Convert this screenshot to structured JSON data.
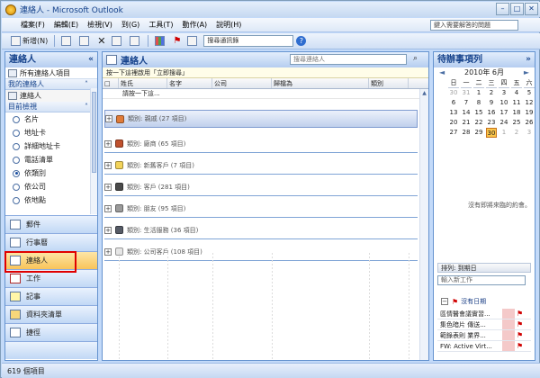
{
  "window": {
    "title": "連絡人 - Microsoft Outlook"
  },
  "menubar": {
    "items": [
      "檔案(F)",
      "編輯(E)",
      "檢視(V)",
      "到(G)",
      "工具(T)",
      "動作(A)",
      "說明(H)"
    ],
    "help_placeholder": "鍵入需要解答的問題"
  },
  "toolbar": {
    "new_label": "新增(N)",
    "address_placeholder": "搜尋通訊錄"
  },
  "nav": {
    "title": "連絡人",
    "all_items": "所有連絡人項目",
    "my_contacts_header": "我的連絡人",
    "my_contacts_item": "連絡人",
    "current_view_header": "目前檢視",
    "views": [
      "名片",
      "地址卡",
      "詳細地址卡",
      "電話清單",
      "依類別",
      "依公司",
      "依地點"
    ],
    "selected_view": 4,
    "buttons": [
      "郵件",
      "行事曆",
      "連絡人",
      "工作",
      "記事",
      "資料夾清單",
      "捷徑"
    ]
  },
  "main": {
    "title": "連絡人",
    "search_placeholder": "搜尋連絡人",
    "hint": "按一下這裡啟用「立即搜尋」",
    "columns": [
      "姓氏",
      "名字",
      "公司",
      "歸檔為",
      "類別"
    ],
    "click_add": "請按一下這...",
    "groups": [
      {
        "label": "類別: 親戚 (27 項目)",
        "color": "#e07b39"
      },
      {
        "label": "類別: 廠商 (65 項目)",
        "color": "#c0512d"
      },
      {
        "label": "類別: 新舊客戶 (7 項目)",
        "color": "#f3d35a"
      },
      {
        "label": "類別: 客戶 (281 項目)",
        "color": "#4a4a4a"
      },
      {
        "label": "類別: 朋友 (95 項目)",
        "color": "#9a9a9a"
      },
      {
        "label": "類別: 生活服務 (36 項目)",
        "color": "#565b66"
      },
      {
        "label": "類別: 公司客戶 (108 項目)",
        "color": "#e6e6e6"
      }
    ]
  },
  "todo": {
    "title": "待辦事項列",
    "month": "2010年 6月",
    "weekdays": [
      "日",
      "一",
      "二",
      "三",
      "四",
      "五",
      "六"
    ],
    "weeks": [
      [
        "30",
        "31",
        "1",
        "2",
        "3",
        "4",
        "5"
      ],
      [
        "6",
        "7",
        "8",
        "9",
        "10",
        "11",
        "12"
      ],
      [
        "13",
        "14",
        "15",
        "16",
        "17",
        "18",
        "19"
      ],
      [
        "20",
        "21",
        "22",
        "23",
        "24",
        "25",
        "26"
      ],
      [
        "27",
        "28",
        "29",
        "30",
        "1",
        "2",
        "3"
      ]
    ],
    "today": "30",
    "no_appointments": "沒有即將來臨的約會。",
    "sort_label": "排列: 到期日",
    "task_placeholder": "輸入新工作",
    "no_date": "沒有日期",
    "tasks": [
      "區情醫會議實習...",
      "集色暗片 傳送...",
      "範錄表則 業界...",
      "FW: Active Virt..."
    ]
  },
  "status": {
    "count": "619 個項目"
  }
}
